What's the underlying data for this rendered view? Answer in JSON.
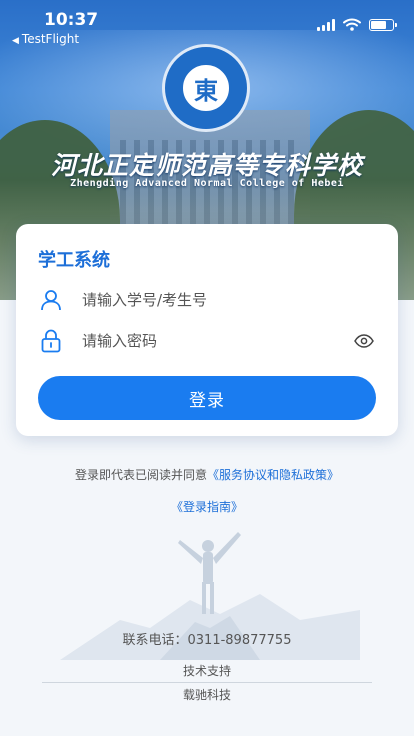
{
  "status_bar": {
    "time": "10:37",
    "back_app": "TestFlight"
  },
  "header": {
    "logo_char": "東",
    "school_name_cn": "河北正定师范高等专科学校",
    "school_name_en": "Zhengding Advanced Normal College of Hebei"
  },
  "login_card": {
    "title": "学工系统",
    "username_placeholder": "请输入学号/考生号",
    "password_placeholder": "请输入密码",
    "login_label": "登录"
  },
  "agreement": {
    "prefix": "登录即代表已阅读并同意",
    "link": "《服务协议和隐私政策》"
  },
  "guide_link": "《登录指南》",
  "footer": {
    "contact": "联系电话：0311-89877755",
    "tech_support": "技术支持",
    "company": "载驰科技"
  },
  "colors": {
    "primary": "#1a7cf0",
    "title": "#1d6fd8",
    "background": "#f3f6fa"
  },
  "icons": [
    "user-icon",
    "lock-icon",
    "eye-icon",
    "signal-icon",
    "wifi-icon",
    "battery-icon"
  ]
}
